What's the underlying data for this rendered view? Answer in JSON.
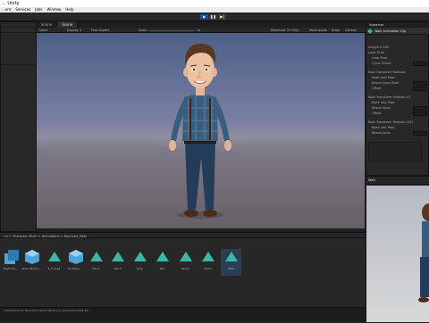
{
  "window": {
    "title": "... Unity"
  },
  "menu": [
    "...ent",
    "Services",
    "Jobs",
    "Window",
    "Help"
  ],
  "toolbar": {
    "play": "▶",
    "pause": "❚❚",
    "step": "▶|"
  },
  "tabs": [
    {
      "label": "Scene"
    },
    {
      "label": "Game"
    }
  ],
  "game_bar": {
    "camera": "Game",
    "display": "Display 1",
    "aspect": "Free Aspect",
    "scale_label": "Scale",
    "scale_value": "1x",
    "maximize": "Maximize On Play",
    "mute": "Mute Audio",
    "stats": "Stats",
    "gizmos": "Gizmos"
  },
  "inspector": {
    "tab": "Inspector",
    "title": "Walk Animation Clip",
    "rows": [
      "Length 0.000",
      "Loop Time",
      "Loop Pose",
      "Cycle Offset",
      "Root Transform Rotation",
      "Bake Into Pose",
      "Based Upon Root",
      "Offset",
      "Root Transform Position (Y)",
      "Bake Into Pose",
      "Based Upon",
      "Offset",
      "Root Transform Position (XZ)",
      "Bake Into Pose",
      "Based Upon"
    ]
  },
  "preview": {
    "tab": "Walk"
  },
  "project": {
    "breadcrumb": "...ts > Character Mixer > Animations > Boyhood_Male",
    "assets": [
      {
        "label": "Boyhood_..."
      },
      {
        "label": "Anim_Motion..."
      },
      {
        "label": "S_T_Pose"
      },
      {
        "label": "SC_Base_..."
      },
      {
        "label": "Idle 1"
      },
      {
        "label": "Idle 2"
      },
      {
        "label": "Jump"
      },
      {
        "label": "Run"
      },
      {
        "label": "Sprint"
      },
      {
        "label": "Swim"
      },
      {
        "label": "Walk"
      }
    ],
    "status_path": "...sets/Character Mixer/Animations/Boyhood_Male/Anim/Walk.fbx"
  },
  "colors": {
    "accent": "#1f4f8a",
    "anim_clip": "#3ab8a6",
    "model": "#4fa3d8",
    "shirt": "#3a5d7d",
    "jeans": "#243b5a",
    "hair": "#5a3520"
  }
}
